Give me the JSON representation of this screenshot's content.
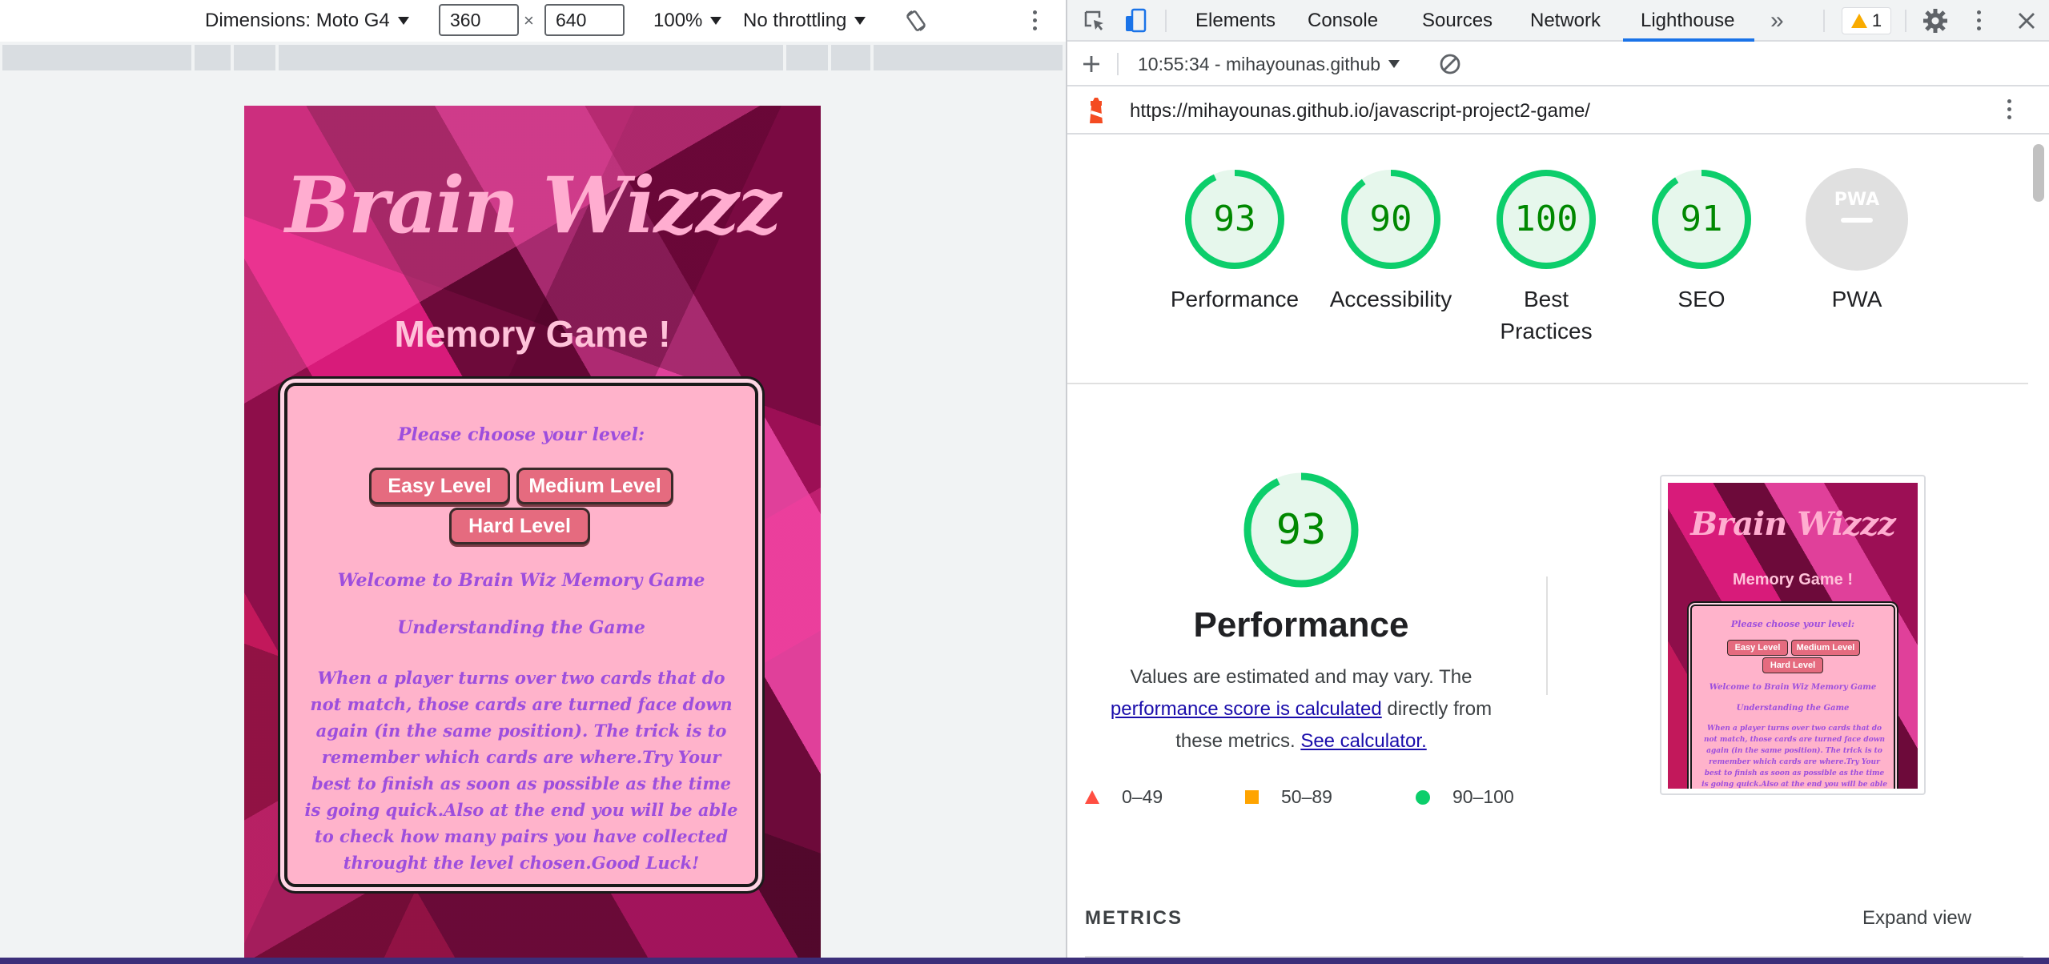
{
  "devbar": {
    "dimensions_label": "Dimensions: Moto G4",
    "width_value": "360",
    "times": "×",
    "height_value": "640",
    "zoom": "100%",
    "throttling": "No throttling"
  },
  "game": {
    "title": "Brain Wizzz",
    "subtitle": "Memory Game !",
    "choose_level": "Please choose your level:",
    "buttons": {
      "easy": "Easy Level",
      "medium": "Medium Level",
      "hard": "Hard Level"
    },
    "welcome": "Welcome to Brain Wiz Memory Game",
    "understanding": "Understanding the Game",
    "description": "When a player turns over two cards that do not match, those cards are turned face down again (in the same position). The trick is to remember which cards are where.Try Your best to finish as soon as possible as the time is going quick.Also at the end you will be able to check how many pairs you have collected throught the level chosen.Good Luck!"
  },
  "devtools": {
    "tabs": [
      "Elements",
      "Console",
      "Sources",
      "Network",
      "Lighthouse"
    ],
    "more_tabs": "»",
    "warning_count": "1",
    "report_time": "10:55:34 - mihayounas.github",
    "url": "https://mihayounas.github.io/javascript-project2-game/"
  },
  "scores": [
    {
      "label": "Performance",
      "value": "93",
      "score": 93
    },
    {
      "label": "Accessibility",
      "value": "90",
      "score": 90
    },
    {
      "label": "Best Practices",
      "value": "100",
      "score": 100
    },
    {
      "label": "SEO",
      "value": "91",
      "score": 91
    },
    {
      "label": "PWA",
      "value": "",
      "score": null
    }
  ],
  "pwa_badge": "PWA",
  "performance": {
    "score": "93",
    "title": "Performance",
    "note_pre": "Values are estimated and may vary. The",
    "note_link": "performance score is calculated",
    "note_mid": "directly from these metrics.",
    "note_link2": "See calculator."
  },
  "legend": {
    "fail": "0–49",
    "average": "50–89",
    "pass": "90–100"
  },
  "metrics_label": "METRICS",
  "expand_view": "Expand view",
  "colors": {
    "pass": "#0cce6b",
    "pass_bg": "#e6f7ec",
    "pass_text": "#008800",
    "average": "#ffa400",
    "fail": "#ff4e42",
    "accent": "#1a73e8"
  }
}
